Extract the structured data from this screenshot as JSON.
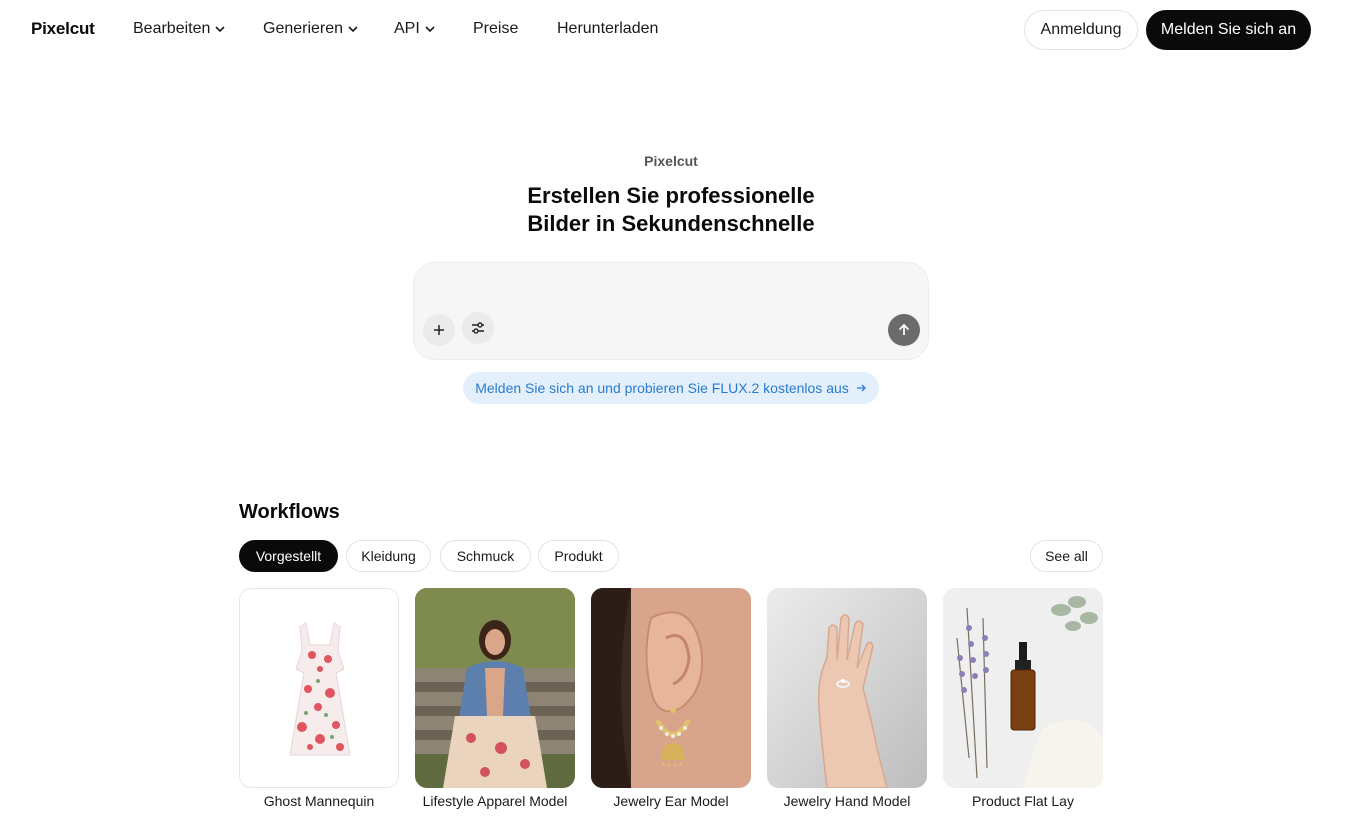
{
  "nav": {
    "logo": "Pixelcut",
    "items": [
      {
        "label": "Bearbeiten",
        "has_dropdown": true
      },
      {
        "label": "Generieren",
        "has_dropdown": true
      },
      {
        "label": "API",
        "has_dropdown": true
      },
      {
        "label": "Preise",
        "has_dropdown": false
      },
      {
        "label": "Herunterladen",
        "has_dropdown": false
      }
    ],
    "login_label": "Anmeldung",
    "signup_label": "Melden Sie sich an"
  },
  "hero": {
    "brand": "Pixelcut",
    "title_line1": "Erstellen Sie professionelle",
    "title_line2": "Bilder in Sekundenschnelle",
    "prompt_placeholder": "",
    "promo_text": "Melden Sie sich an und probieren Sie FLUX.2 kostenlos aus",
    "promo_icon": "arrow-right-icon"
  },
  "workflows": {
    "title": "Workflows",
    "filters": [
      {
        "label": "Vorgestellt",
        "active": true
      },
      {
        "label": "Kleidung",
        "active": false
      },
      {
        "label": "Schmuck",
        "active": false
      },
      {
        "label": "Produkt",
        "active": false
      }
    ],
    "see_all_label": "See all",
    "cards": [
      {
        "label": "Ghost Mannequin"
      },
      {
        "label": "Lifestyle Apparel Model"
      },
      {
        "label": "Jewelry Ear Model"
      },
      {
        "label": "Jewelry Hand Model"
      },
      {
        "label": "Product Flat Lay"
      }
    ]
  },
  "colors": {
    "primary": "#0a0a0a",
    "promo_bg": "#e3f0fb",
    "promo_text": "#2a7bd0",
    "send_button": "#6b6b6b"
  }
}
